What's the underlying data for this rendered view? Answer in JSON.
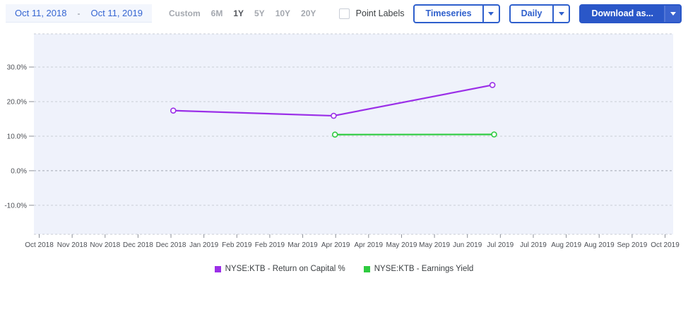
{
  "header": {
    "date_range": {
      "start": "Oct 11, 2018",
      "separator": "-",
      "end": "Oct 11, 2019"
    },
    "range_options": [
      {
        "label": "Custom",
        "selected": false
      },
      {
        "label": "6M",
        "selected": false
      },
      {
        "label": "1Y",
        "selected": true
      },
      {
        "label": "5Y",
        "selected": false
      },
      {
        "label": "10Y",
        "selected": false
      },
      {
        "label": "20Y",
        "selected": false
      }
    ],
    "point_labels": {
      "label": "Point Labels",
      "checked": false
    },
    "timeseries_button": {
      "label": "Timeseries",
      "icon": "chevron-down-icon"
    },
    "frequency_button": {
      "label": "Daily",
      "icon": "chevron-down-icon"
    },
    "download_button": {
      "label": "Download as...",
      "icon": "chevron-down-icon"
    }
  },
  "colors": {
    "accent_blue": "#2e5fcc",
    "download_button_bg": "#2a57c8",
    "date_text": "#3565d2",
    "plot_background": "#eff2fb",
    "gridline": "#c9cdd6",
    "zero_line": "#a2a7b2",
    "axis_text": "#4c4f55",
    "series_purple": "#9b2fe8",
    "series_green": "#2ecb40"
  },
  "chart_data": {
    "type": "line",
    "title": "",
    "xlabel": "",
    "ylabel": "",
    "x_units": "tick-index",
    "x_tick_labels": [
      "Oct 2018",
      "Nov 2018",
      "Nov 2018",
      "Dec 2018",
      "Dec 2018",
      "Jan 2019",
      "Feb 2019",
      "Feb 2019",
      "Mar 2019",
      "Apr 2019",
      "Apr 2019",
      "May 2019",
      "May 2019",
      "Jun 2019",
      "Jul 2019",
      "Jul 2019",
      "Aug 2019",
      "Aug 2019",
      "Sep 2019",
      "Oct 2019"
    ],
    "y_ticks": [
      {
        "value": 30,
        "label": "30.0%"
      },
      {
        "value": 20,
        "label": "20.0%"
      },
      {
        "value": 10,
        "label": "10.0%"
      },
      {
        "value": 0,
        "label": "0.0%"
      },
      {
        "value": -10,
        "label": "-10.0%"
      }
    ],
    "ylim": [
      -18.4,
      39.6
    ],
    "grid": "horizontal-dashed",
    "legend_position": "bottom-center",
    "marker": "open-circle",
    "series": [
      {
        "name": "NYSE:KTB - Return on Capital %",
        "color": "#9b2fe8",
        "points": [
          {
            "x": 4.07,
            "y": 17.4
          },
          {
            "x": 8.94,
            "y": 15.9
          },
          {
            "x": 13.76,
            "y": 24.8
          }
        ]
      },
      {
        "name": "NYSE:KTB - Earnings Yield",
        "color": "#2ecb40",
        "points": [
          {
            "x": 8.98,
            "y": 10.45
          },
          {
            "x": 13.81,
            "y": 10.5
          }
        ]
      }
    ]
  }
}
